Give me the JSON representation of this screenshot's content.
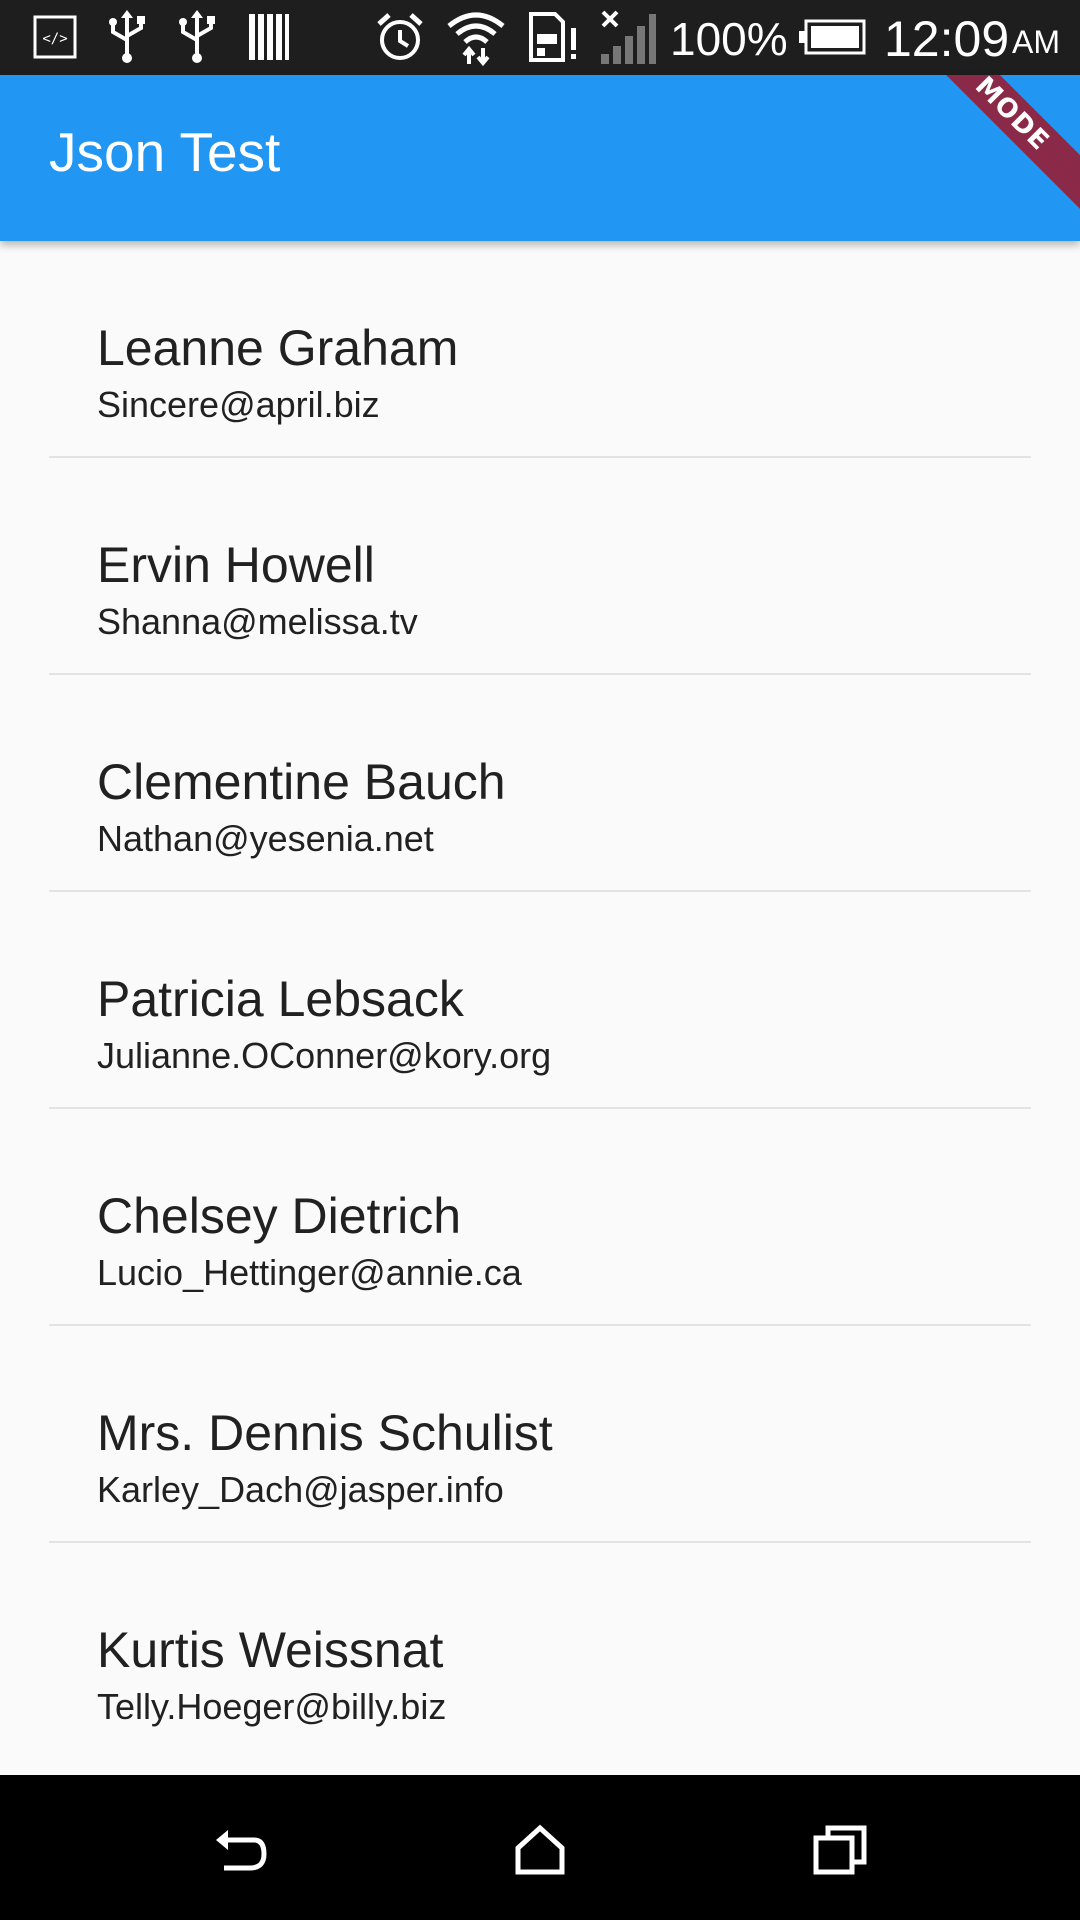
{
  "status_bar": {
    "battery_percent": "100%",
    "time": "12:09",
    "am_pm": "AM",
    "icons": [
      "developer-icon",
      "usb-icon",
      "usb-icon",
      "barcode-icon",
      "alarm-icon",
      "wifi-icon",
      "sd-card-icon",
      "signal-icon",
      "battery-icon"
    ]
  },
  "app_bar": {
    "title": "Json Test",
    "debug_banner": "MODE",
    "color": "#2196f3"
  },
  "users": [
    {
      "name": "Leanne Graham",
      "email": "Sincere@april.biz"
    },
    {
      "name": "Ervin Howell",
      "email": "Shanna@melissa.tv"
    },
    {
      "name": "Clementine Bauch",
      "email": "Nathan@yesenia.net"
    },
    {
      "name": "Patricia Lebsack",
      "email": "Julianne.OConner@kory.org"
    },
    {
      "name": "Chelsey Dietrich",
      "email": "Lucio_Hettinger@annie.ca"
    },
    {
      "name": "Mrs. Dennis Schulist",
      "email": "Karley_Dach@jasper.info"
    },
    {
      "name": "Kurtis Weissnat",
      "email": "Telly.Hoeger@billy.biz"
    }
  ],
  "nav_bar": {
    "icons": [
      "back-icon",
      "home-icon",
      "recents-icon"
    ]
  }
}
